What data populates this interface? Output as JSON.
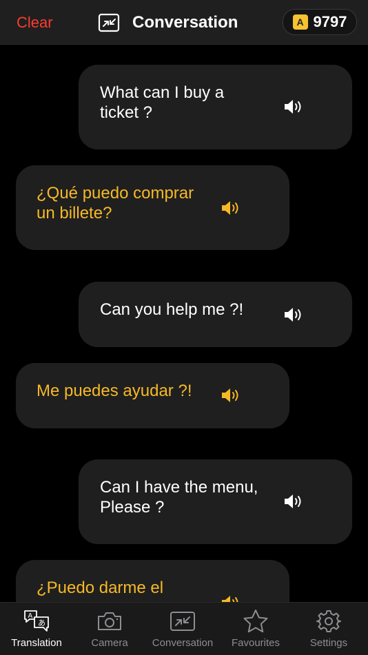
{
  "header": {
    "clear_label": "Clear",
    "title": "Conversation",
    "coin_letter": "A",
    "coin_count": "9797"
  },
  "messages": [
    {
      "text_line1": "What can I buy a",
      "text_line2": "ticket ?",
      "side": "mine"
    },
    {
      "text_line1": "¿Qué puedo comprar",
      "text_line2": "un billete?",
      "side": "theirs"
    },
    {
      "text_line1": "Can you help me ?!",
      "text_line2": "",
      "side": "mine"
    },
    {
      "text_line1": "Me puedes ayudar ?!",
      "text_line2": "",
      "side": "theirs"
    },
    {
      "text_line1": "Can I have the menu,",
      "text_line2": "Please ?",
      "side": "mine"
    },
    {
      "text_line1": "¿Puedo darme el",
      "text_line2": "",
      "side": "theirs"
    }
  ],
  "tabs": [
    {
      "label": "Translation",
      "icon": "translation-icon"
    },
    {
      "label": "Camera",
      "icon": "camera-icon"
    },
    {
      "label": "Conversation",
      "icon": "conversation-icon"
    },
    {
      "label": "Favourites",
      "icon": "star-icon"
    },
    {
      "label": "Settings",
      "icon": "gear-icon"
    }
  ],
  "colors": {
    "accent_red": "#ff3b30",
    "accent_yellow": "#f6b926",
    "bubble_bg": "#1f1f1f",
    "inactive_tab": "#8e8e93"
  }
}
